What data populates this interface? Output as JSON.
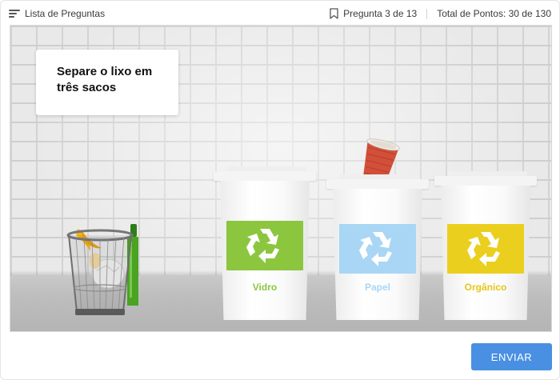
{
  "header": {
    "question_list_label": "Lista de Preguntas",
    "question_counter": "Pregunta 3 de 13",
    "score": "Total de Pontos: 30 de 130"
  },
  "task": {
    "instruction": "Separe o lixo em três sacos"
  },
  "bins": [
    {
      "label": "Vidro",
      "color": "#8cc63f"
    },
    {
      "label": "Papel",
      "color": "#a9d6f5"
    },
    {
      "label": "Orgânico",
      "color": "#ebcf1f"
    }
  ],
  "icons": {
    "list": "list-icon",
    "bookmark": "bookmark-icon",
    "recycle": "recycle-icon"
  },
  "footer": {
    "submit_label": "ENVIAR",
    "submit_color": "#4a90e2"
  }
}
